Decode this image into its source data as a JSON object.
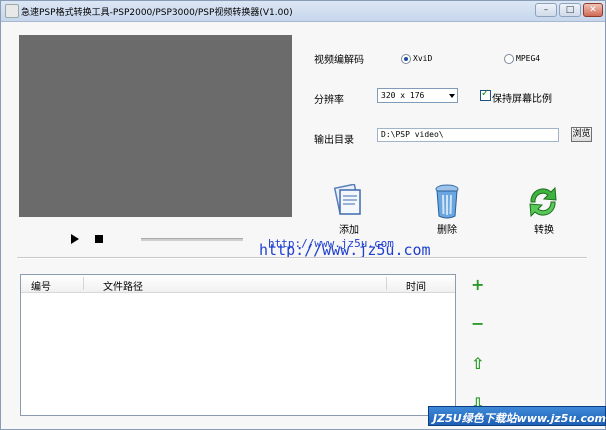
{
  "window": {
    "title": "急速PSP格式转换工具-PSP2000/PSP3000/PSP视频转换器(V1.00)",
    "controls": {
      "min": "–",
      "max": "□",
      "close": "✕"
    }
  },
  "settings": {
    "codec_label": "视频编解码",
    "codec_options": [
      "XviD",
      "MPEG4"
    ],
    "resolution_label": "分辨率",
    "resolution_value": "320 x 176",
    "keep_ratio_label": "保持屏幕比例",
    "output_label": "输出目录",
    "output_value": "D:\\PSP video\\",
    "browse_label": "浏览"
  },
  "actions": {
    "add": "添加",
    "delete": "删除",
    "convert": "转换"
  },
  "urls": {
    "small": "http://www.jz5u.com",
    "large": "http://www.jz5u.com"
  },
  "table": {
    "columns": [
      "编号",
      "文件路径",
      "时间"
    ]
  },
  "side": {
    "add": "+",
    "remove": "−",
    "up": "⇧",
    "down": "⇩"
  },
  "watermark": "JZ5U绿色下载站www.jz5u.com",
  "colors": {
    "titlebar": "#c6d6ec",
    "video": "#6b6b6b",
    "url": "#1f3fd0",
    "side_icon": "#2b9a2b",
    "watermark": "#1d5fb5"
  }
}
